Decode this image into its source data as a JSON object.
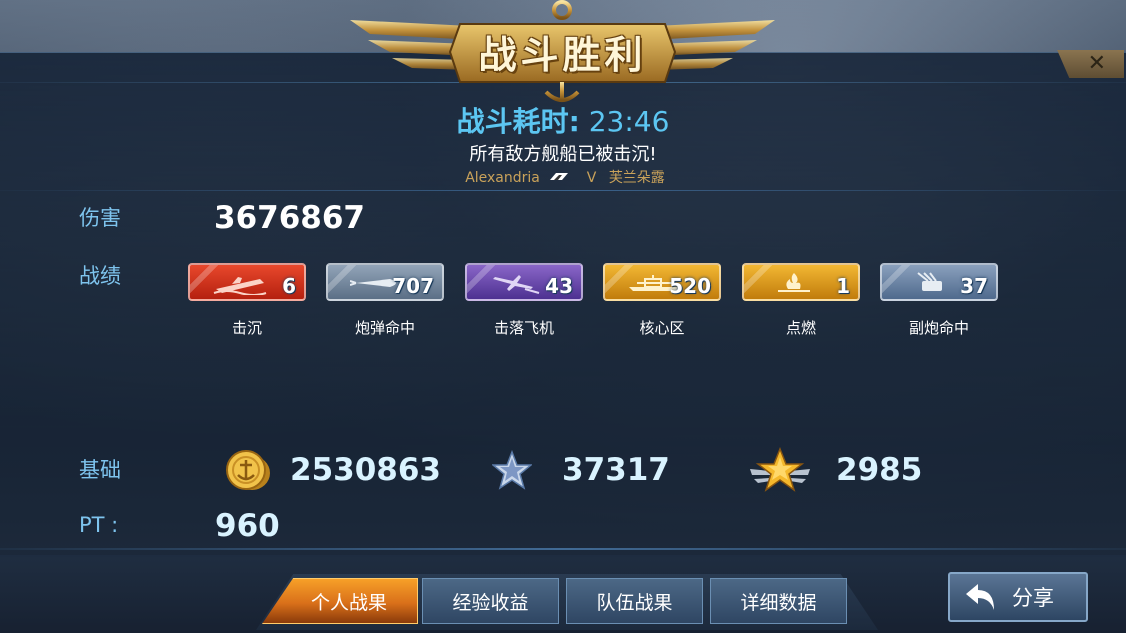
{
  "header": {
    "title": "战斗胜利",
    "close_symbol": "✕"
  },
  "battle": {
    "time_label": "战斗耗时:",
    "time_value": "23:46",
    "result_message": "所有敌方舰船已被击沉!",
    "player_ship": "Alexandria",
    "versus": "V",
    "opponent_ship": "芙兰朵露"
  },
  "damage": {
    "label": "伤害",
    "value": "3676867"
  },
  "stats": {
    "label": "战绩",
    "items": [
      {
        "label": "击沉",
        "value": "6",
        "color": "#d8321c",
        "icon": "ship-sinking-icon"
      },
      {
        "label": "炮弹命中",
        "value": "707",
        "color": "#7a8da3",
        "icon": "shell-icon"
      },
      {
        "label": "击落飞机",
        "value": "43",
        "color": "#6a4aa8",
        "icon": "aircraft-icon"
      },
      {
        "label": "核心区",
        "value": "520",
        "color": "#d99a14",
        "icon": "ship-core-icon"
      },
      {
        "label": "点燃",
        "value": "1",
        "color": "#d99a14",
        "icon": "fire-icon"
      },
      {
        "label": "副炮命中",
        "value": "37",
        "color": "#6b84a5",
        "icon": "secondary-gun-icon"
      }
    ]
  },
  "base": {
    "label": "基础",
    "coins": "2530863",
    "experience": "37317",
    "rank_points": "2985",
    "coin_icon": "gold-coin-icon",
    "exp_icon": "silver-star-icon",
    "rank_icon": "gold-winged-star-icon"
  },
  "pt": {
    "label": "PT :",
    "value": "960"
  },
  "tabs": [
    {
      "label": "个人战果",
      "active": true
    },
    {
      "label": "经验收益",
      "active": false
    },
    {
      "label": "队伍战果",
      "active": false
    },
    {
      "label": "详细数据",
      "active": false
    }
  ],
  "share": {
    "label": "分享",
    "icon": "return-arrow-icon"
  },
  "colors": {
    "accent_blue": "#5cc6f2",
    "label_blue": "#7ec4ee",
    "gold": "#c9a25a",
    "active_tab": "#f7a028"
  }
}
